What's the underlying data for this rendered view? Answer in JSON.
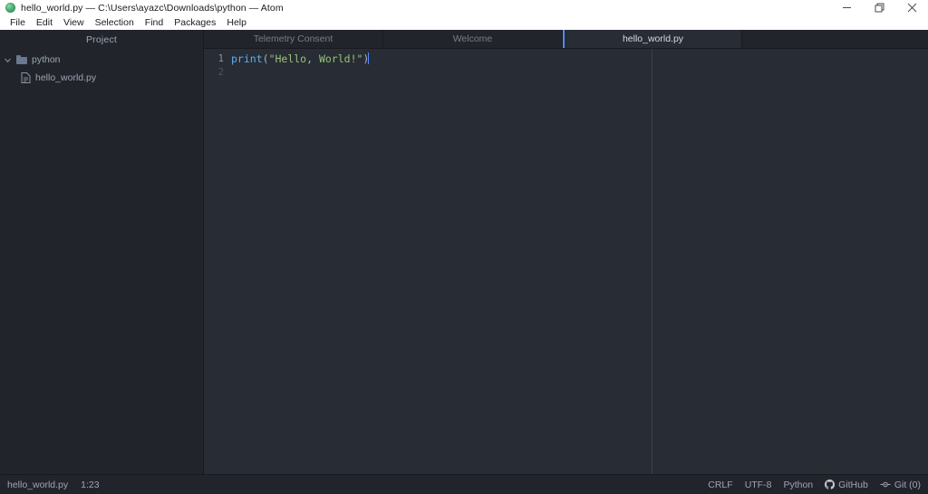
{
  "window": {
    "title": "hello_world.py — C:\\Users\\ayazc\\Downloads\\python — Atom",
    "app_icon": "atom-icon",
    "controls": {
      "minimize": "minimize-icon",
      "maximize": "restore-icon",
      "close": "close-icon"
    }
  },
  "menubar": {
    "items": [
      {
        "label": "File"
      },
      {
        "label": "Edit"
      },
      {
        "label": "View"
      },
      {
        "label": "Selection"
      },
      {
        "label": "Find"
      },
      {
        "label": "Packages"
      },
      {
        "label": "Help"
      }
    ]
  },
  "treeview": {
    "header": "Project",
    "items": [
      {
        "label": "python",
        "icon": "folder-icon",
        "expanded": true,
        "depth": 0
      },
      {
        "label": "hello_world.py",
        "icon": "file-icon",
        "expanded": false,
        "depth": 1
      }
    ]
  },
  "tabs": [
    {
      "label": "Telemetry Consent",
      "active": false
    },
    {
      "label": "Welcome",
      "active": false
    },
    {
      "label": "hello_world.py",
      "active": true
    }
  ],
  "editor": {
    "line_numbers": [
      "1",
      "2"
    ],
    "code": {
      "function": "print",
      "open_paren": "(",
      "string": "\"Hello, World!\"",
      "close_paren": ")"
    },
    "cursor_visible": true
  },
  "statusbar": {
    "left": [
      {
        "label": "hello_world.py",
        "name": "status-file-name"
      },
      {
        "label": "1:23",
        "name": "status-cursor-position"
      }
    ],
    "right": [
      {
        "label": "CRLF",
        "name": "status-line-ending",
        "icon": null
      },
      {
        "label": "UTF-8",
        "name": "status-encoding",
        "icon": null
      },
      {
        "label": "Python",
        "name": "status-grammar",
        "icon": null
      },
      {
        "label": "GitHub",
        "name": "status-github",
        "icon": "github-icon"
      },
      {
        "label": "Git (0)",
        "name": "status-git",
        "icon": "git-branch-icon"
      }
    ]
  },
  "colors": {
    "titlebar_bg": "#ffffff",
    "editor_bg": "#282c34",
    "chrome_bg": "#21252b",
    "accent_blue": "#568af2",
    "cursor_blue": "#528bff",
    "text_muted": "#9da5b4",
    "syntax_function": "#61afef",
    "syntax_string": "#98c379",
    "syntax_punct": "#abb2bf"
  }
}
